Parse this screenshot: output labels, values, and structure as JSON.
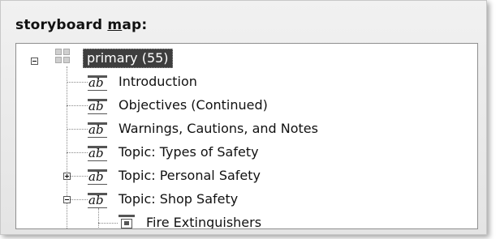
{
  "panel": {
    "title_pre": "storyboard ",
    "title_u": "m",
    "title_post": "ap:"
  },
  "tree": {
    "root": {
      "label": "primary (55)",
      "icon": "grid-icon",
      "expanded": true,
      "selected": true
    },
    "children": [
      {
        "label": "Introduction",
        "icon": "text-ab-icon",
        "expander": "none"
      },
      {
        "label": "Objectives (Continued)",
        "icon": "text-ab-icon",
        "expander": "none"
      },
      {
        "label": "Warnings, Cautions, and Notes",
        "icon": "text-ab-icon",
        "expander": "none"
      },
      {
        "label": "Topic: Types of Safety",
        "icon": "text-ab-icon",
        "expander": "none"
      },
      {
        "label": "Topic: Personal Safety",
        "icon": "text-ab-icon",
        "expander": "plus"
      },
      {
        "label": "Topic: Shop Safety",
        "icon": "text-ab-icon",
        "expander": "minus",
        "children": [
          {
            "label": "Fire Extinguishers",
            "icon": "page-graphic-icon"
          }
        ]
      }
    ]
  }
}
